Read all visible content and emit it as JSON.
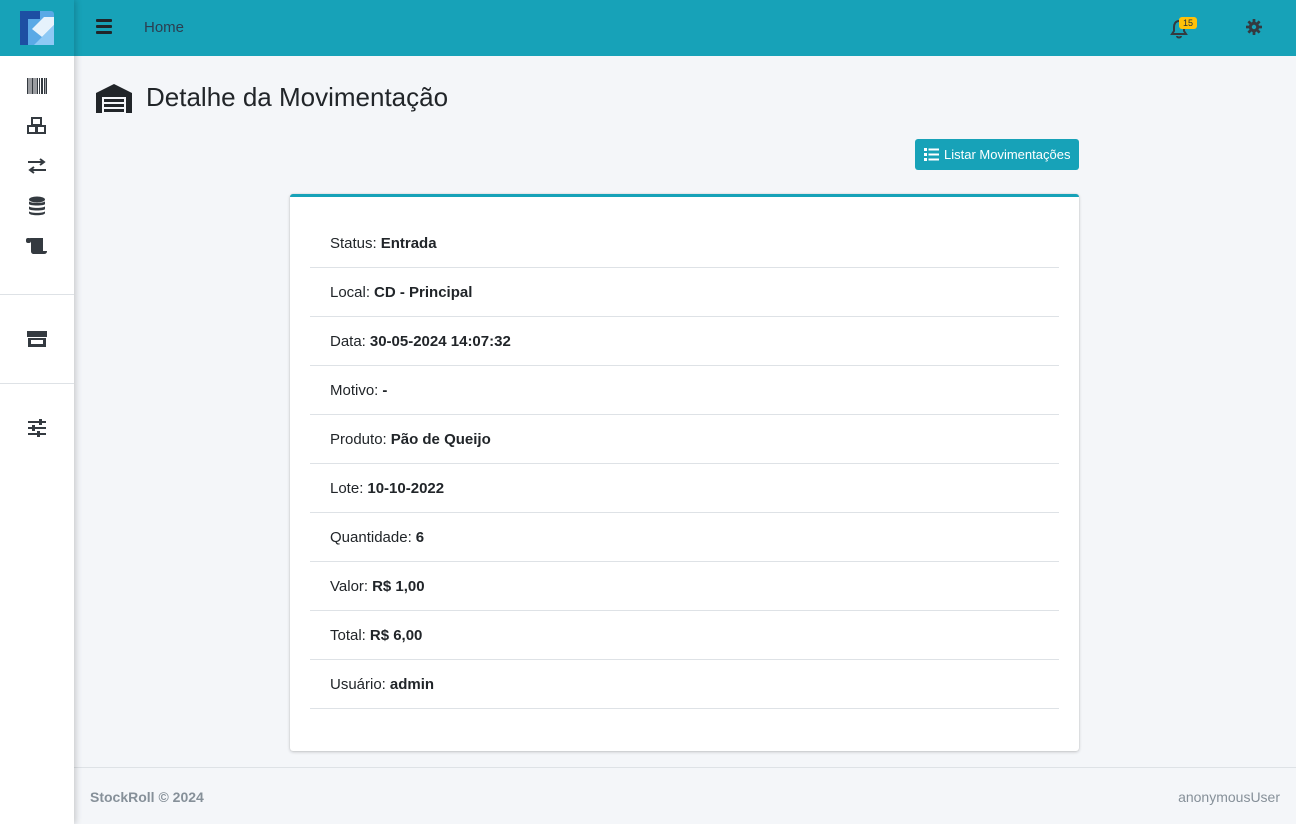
{
  "topbar": {
    "home_label": "Home",
    "notification_count": "15",
    "accent_color": "#17a2b8"
  },
  "sidebar": {
    "items": [
      {
        "icon": "barcode-icon"
      },
      {
        "icon": "boxes-icon"
      },
      {
        "icon": "exchange-arrows-icon"
      },
      {
        "icon": "database-icon"
      },
      {
        "icon": "scroll-icon"
      },
      {
        "icon": "store-icon"
      },
      {
        "icon": "sliders-icon"
      }
    ]
  },
  "page": {
    "title": "Detalhe da Movimentação",
    "title_icon": "warehouse-icon",
    "list_button_label": "Listar Movimentações"
  },
  "details": [
    {
      "label": "Status:",
      "value": "Entrada"
    },
    {
      "label": "Local:",
      "value": "CD - Principal"
    },
    {
      "label": "Data:",
      "value": "30-05-2024 14:07:32"
    },
    {
      "label": "Motivo:",
      "value": "-"
    },
    {
      "label": "Produto:",
      "value": "Pão de Queijo"
    },
    {
      "label": "Lote:",
      "value": "10-10-2022"
    },
    {
      "label": "Quantidade:",
      "value": "6"
    },
    {
      "label": "Valor:",
      "value": "R$ 1,00"
    },
    {
      "label": "Total:",
      "value": "R$ 6,00"
    },
    {
      "label": "Usuário:",
      "value": "admin"
    }
  ],
  "footer": {
    "copyright": "StockRoll © 2024",
    "user": "anonymousUser"
  }
}
